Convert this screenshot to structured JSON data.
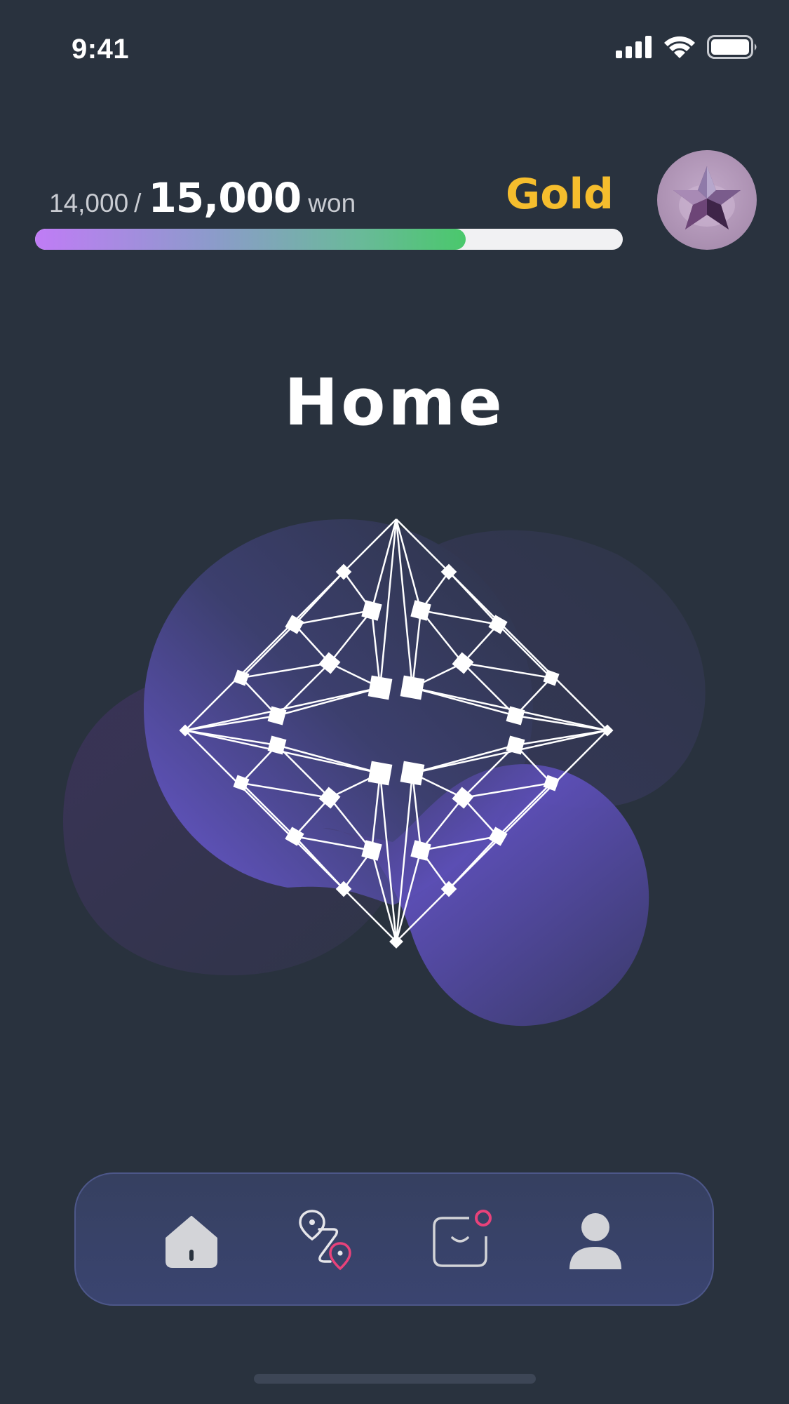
{
  "status_bar": {
    "time": "9:41"
  },
  "progress": {
    "current": "14,000",
    "separator": "/",
    "goal": "15,000",
    "unit": "won",
    "fraction": 0.733,
    "tier": "Gold",
    "tier_color": "#f5bd2d"
  },
  "avatar": {
    "icon": "star-badge-icon"
  },
  "page": {
    "title": "Home"
  },
  "nav": {
    "items": [
      {
        "icon": "home-icon",
        "active": true
      },
      {
        "icon": "route-icon",
        "active": false
      },
      {
        "icon": "mail-icon",
        "badge": true
      },
      {
        "icon": "profile-icon",
        "active": false
      }
    ]
  },
  "colors": {
    "background": "#29323e",
    "accent_pink": "#e8427a",
    "blob_purple": "#6a57cf"
  }
}
